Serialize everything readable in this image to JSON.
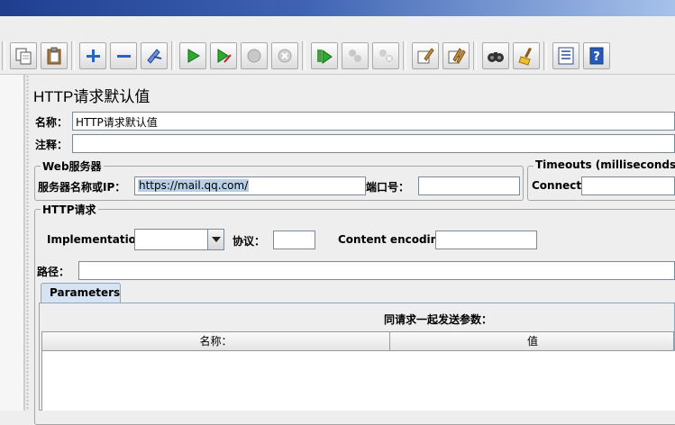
{
  "toolbar": {
    "buttons": [
      "copy-icon",
      "paste-icon",
      "add-icon",
      "remove-icon",
      "clear-icon",
      "start-icon",
      "start-no-timers-icon",
      "stop-icon",
      "shutdown-icon",
      "remote-start-icon",
      "remote-stop-icon",
      "remote-shutdown-icon",
      "clear-results-icon",
      "clear-all-icon",
      "search-icon",
      "reset-search-icon",
      "function-helper-icon",
      "help-icon"
    ]
  },
  "page": {
    "title": "HTTP请求默认值",
    "name_label": "名称：",
    "name_value": "HTTP请求默认值",
    "comment_label": "注释：",
    "comment_value": ""
  },
  "web_server": {
    "group_title": "Web服务器",
    "server_label": "服务器名称或IP：",
    "server_value": "https://mail.qq.com/",
    "port_label": "端口号：",
    "port_value": ""
  },
  "timeouts": {
    "group_title": "Timeouts (milliseconds)",
    "connect_label": "Connect:",
    "connect_value": ""
  },
  "http_request": {
    "group_title": "HTTP请求",
    "implementation_label": "Implementation:",
    "implementation_value": "",
    "protocol_label": "协议：",
    "protocol_value": "",
    "encoding_label": "Content encoding:",
    "encoding_value": "",
    "path_label": "路径：",
    "path_value": ""
  },
  "parameters": {
    "tab_label": "Parameters",
    "caption": "同请求一起发送参数：",
    "columns": [
      "名称：",
      "值"
    ]
  }
}
